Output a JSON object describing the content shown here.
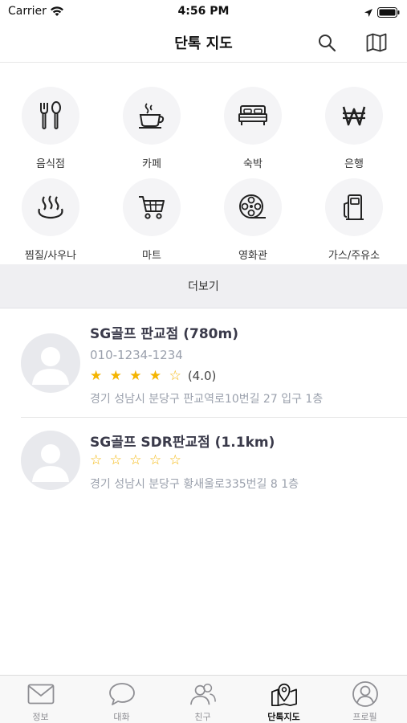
{
  "status_bar": {
    "carrier": "Carrier",
    "time": "4:56 PM",
    "icons": [
      "wifi-icon",
      "location-arrow-icon",
      "battery-icon"
    ]
  },
  "nav": {
    "title": "단톡 지도",
    "actions": [
      "search-icon",
      "map-icon"
    ]
  },
  "categories": [
    {
      "label": "음식점",
      "icon": "fork-spoon-icon"
    },
    {
      "label": "카페",
      "icon": "coffee-cup-icon"
    },
    {
      "label": "숙박",
      "icon": "bed-icon"
    },
    {
      "label": "은행",
      "icon": "won-sign-icon"
    },
    {
      "label": "찜질/사우나",
      "icon": "hot-spring-icon"
    },
    {
      "label": "마트",
      "icon": "shopping-cart-icon"
    },
    {
      "label": "영화관",
      "icon": "film-reel-icon"
    },
    {
      "label": "가스/주유소",
      "icon": "gas-pump-icon"
    }
  ],
  "more_label": "더보기",
  "places": [
    {
      "name": "SG골프 판교점 (780m)",
      "phone": "010-1234-1234",
      "stars": "★ ★ ★ ★ ☆",
      "rating": "(4.0)",
      "rating_value": 4.0,
      "address": "경기 성남시 분당구 판교역로10번길 27 입구 1층"
    },
    {
      "name": "SG골프 SDR판교점 (1.1km)",
      "phone": "",
      "stars": "☆ ☆ ☆ ☆ ☆",
      "rating": "",
      "rating_value": 0,
      "address": "경기 성남시 분당구 황새울로335번길 8 1층"
    }
  ],
  "tabs": [
    {
      "label": "정보",
      "icon": "envelope-icon",
      "active": false
    },
    {
      "label": "대화",
      "icon": "chat-bubble-icon",
      "active": false
    },
    {
      "label": "친구",
      "icon": "friends-icon",
      "active": false
    },
    {
      "label": "단톡지도",
      "icon": "map-pin-icon",
      "active": true
    },
    {
      "label": "프로필",
      "icon": "profile-icon",
      "active": false
    }
  ],
  "colors": {
    "star": "#f4b400",
    "secondary_text": "#9aa0ac",
    "tab_inactive": "#8e8e93",
    "more_bar_bg": "#efeff2"
  }
}
